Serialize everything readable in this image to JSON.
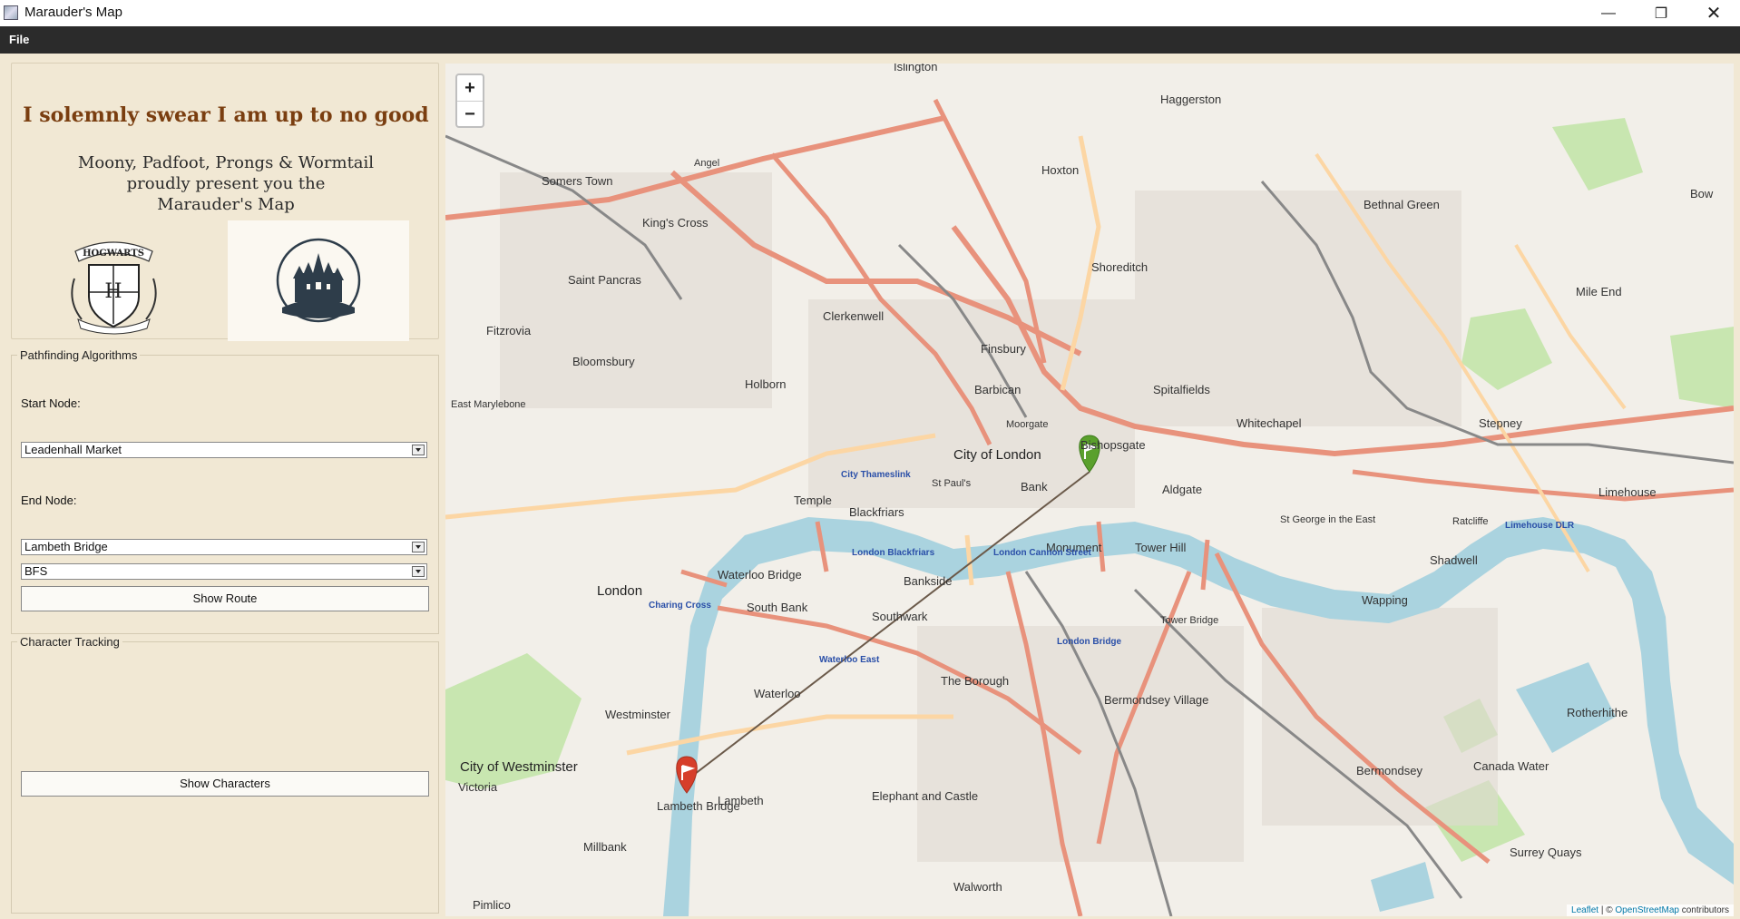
{
  "window": {
    "title": "Marauder's Map",
    "minimize_glyph": "—",
    "maximize_glyph": "❐",
    "close_glyph": "✕"
  },
  "menu": {
    "file": "File"
  },
  "header": {
    "oath": "I solemnly swear I am up to no good",
    "present_lines": [
      "Moony, Padfoot, Prongs & Wormtail",
      "proudly present you the",
      "Marauder's Map"
    ],
    "crest_text": "HOGWARTS"
  },
  "pathfinding": {
    "title": "Pathfinding Algorithms",
    "start_label": "Start Node:",
    "start_value": "Leadenhall Market",
    "end_label": "End Node:",
    "end_value": "Lambeth Bridge",
    "algorithm_value": "BFS",
    "show_route": "Show Route"
  },
  "characters": {
    "title": "Character Tracking",
    "show_characters": "Show Characters"
  },
  "map": {
    "zoom_in": "+",
    "zoom_out": "−",
    "attribution_leaflet": "Leaflet",
    "attribution_sep": " | © ",
    "attribution_osm": "OpenStreetMap",
    "attribution_tail": " contributors",
    "route_color": "#6b5a4a",
    "start_marker_color": "#5aa02c",
    "end_marker_color": "#d63e2a",
    "river_color": "#aad3df",
    "labels": {
      "islington": "Islington",
      "haggerston": "Haggerston",
      "somers_town": "Somers Town",
      "kings_cross": "King's Cross",
      "hoxton": "Hoxton",
      "bethnal_green": "Bethnal Green",
      "saint_pancras": "Saint Pancras",
      "shoreditch": "Shoreditch",
      "clerkenwell": "Clerkenwell",
      "finsbury": "Finsbury",
      "mile_end": "Mile End",
      "fitzrovia": "Fitzrovia",
      "bloomsbury": "Bloomsbury",
      "holborn": "Holborn",
      "barbican": "Barbican",
      "spitalfields": "Spitalfields",
      "whitechapel": "Whitechapel",
      "stepney": "Stepney",
      "city_of_london": "City of London",
      "bishopsgate": "Bishopsgate",
      "aldgate": "Aldgate",
      "limehouse": "Limehouse",
      "temple": "Temple",
      "blackfriars": "Blackfriars",
      "bank": "Bank",
      "monument": "Monument",
      "tower_hill": "Tower Hill",
      "shadwell": "Shadwell",
      "london": "London",
      "waterloo_bridge": "Waterloo Bridge",
      "south_bank": "South Bank",
      "bankside": "Bankside",
      "southwark": "Southwark",
      "wapping": "Wapping",
      "waterloo": "Waterloo",
      "the_borough": "The Borough",
      "rotherhithe": "Rotherhithe",
      "westminster": "Westminster",
      "bermondsey_village": "Bermondsey Village",
      "city_of_westminster": "City of Westminster",
      "bermondsey": "Bermondsey",
      "canada_water": "Canada Water",
      "victoria": "Victoria",
      "lambeth": "Lambeth",
      "lambeth_bridge": "Lambeth Bridge",
      "elephant_and_castle": "Elephant and Castle",
      "millbank": "Millbank",
      "walworth": "Walworth",
      "surrey_quays": "Surrey Quays",
      "pimlico": "Pimlico",
      "east_marylebone": "East Marylebone",
      "city_thameslink": "City Thameslink",
      "london_blackfriars": "London Blackfriars",
      "london_cannon_street": "London Cannon Street",
      "london_bridge": "London Bridge",
      "tower_bridge": "Tower Bridge",
      "charing_cross": "Charing Cross",
      "waterloo_east": "Waterloo East",
      "limehouse_dlr": "Limehouse DLR",
      "st_george": "St George in the East",
      "ratcliffe": "Ratcliffe",
      "angel": "Angel",
      "st_pauls": "St Paul's",
      "moorgate": "Moorgate",
      "bow": "Bow"
    }
  }
}
